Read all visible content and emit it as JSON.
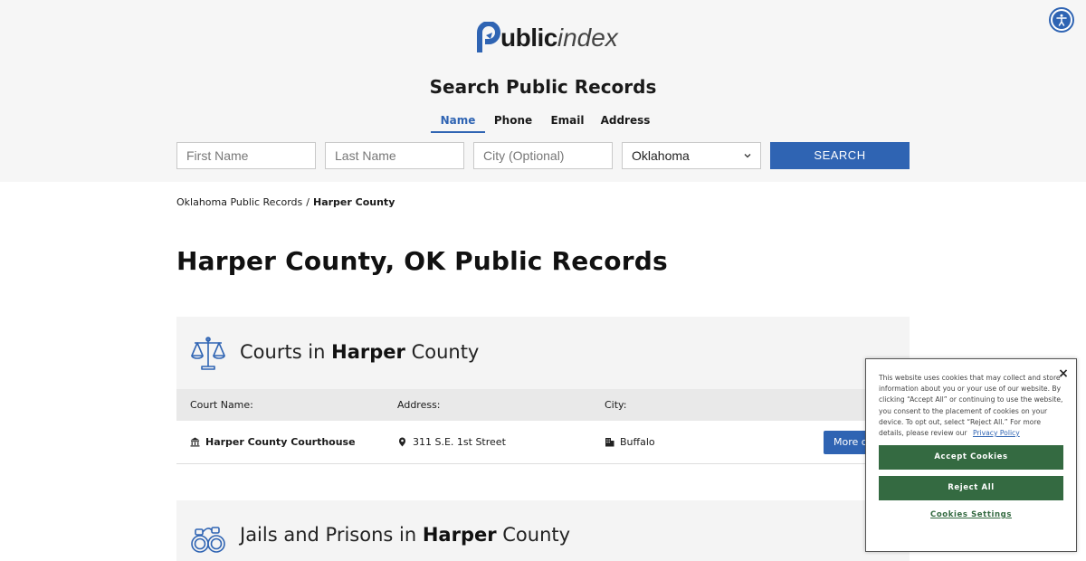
{
  "header": {
    "logo_bold": "ublic",
    "logo_light": "index",
    "search_title": "Search Public Records",
    "tabs": [
      {
        "label": "Name",
        "active": true
      },
      {
        "label": "Phone",
        "active": false
      },
      {
        "label": "Email",
        "active": false
      },
      {
        "label": "Address",
        "active": false
      }
    ],
    "inputs": {
      "first_placeholder": "First Name",
      "last_placeholder": "Last Name",
      "city_placeholder": "City (Optional)"
    },
    "state_select": "Oklahoma",
    "search_label": "SEARCH"
  },
  "breadcrumb": {
    "parent": "Oklahoma Public Records",
    "separator": "/",
    "current": "Harper County"
  },
  "page_title": "Harper County, OK Public Records",
  "courts": {
    "title_prefix": "Courts in",
    "title_bold": "Harper",
    "title_suffix": "County",
    "columns": [
      "Court Name:",
      "Address:",
      "City:"
    ],
    "rows": [
      {
        "name": "Harper County Courthouse",
        "address": "311 S.E. 1st Street",
        "city": "Buffalo",
        "button": "More d"
      }
    ]
  },
  "jails": {
    "title_prefix": "Jails and Prisons in",
    "title_bold": "Harper",
    "title_suffix": "County"
  },
  "cookie": {
    "text": "This website uses cookies that may collect and store information about you or your use of our website. By clicking “Accept All” or continuing to use the website, you consent to the placement of cookies on your device. To opt out, select “Reject All.” For more details, please review our",
    "link": "Privacy Policy",
    "accept": "Accept Cookies",
    "reject": "Reject All",
    "settings": "Cookies Settings",
    "close": "×"
  },
  "colors": {
    "brand_blue": "#2f64b3",
    "cookie_green": "#346a41",
    "header_bg": "#f6f6f6"
  },
  "icons": {
    "logo": "logo-p-arrow-icon",
    "accessibility": "accessibility-person-icon",
    "courts": "scales-of-justice-icon",
    "jails": "handcuffs-icon",
    "court_row": "courthouse-icon",
    "address": "map-pin-icon",
    "city": "building-icon",
    "select": "chevron-down-icon"
  }
}
